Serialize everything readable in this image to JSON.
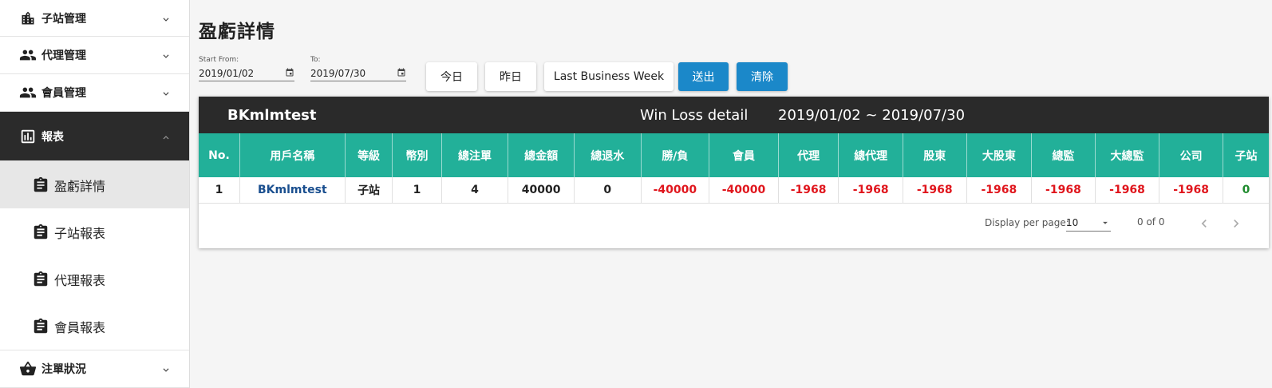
{
  "sidebar": {
    "items": [
      {
        "label": "子站管理",
        "icon": "building-icon"
      },
      {
        "label": "代理管理",
        "icon": "people-icon"
      },
      {
        "label": "會員管理",
        "icon": "people-icon"
      },
      {
        "label": "報表",
        "icon": "chart-icon"
      }
    ],
    "sub_items": [
      {
        "label": "盈虧詳情",
        "icon": "clipboard-icon"
      },
      {
        "label": "子站報表",
        "icon": "clipboard-icon"
      },
      {
        "label": "代理報表",
        "icon": "clipboard-icon"
      },
      {
        "label": "會員報表",
        "icon": "clipboard-icon"
      }
    ],
    "last_item": {
      "label": "注單狀況",
      "icon": "basket-icon"
    }
  },
  "page": {
    "title": "盈虧詳情"
  },
  "filters": {
    "start_label": "Start From:",
    "start_value": "2019/01/02",
    "to_label": "To:",
    "to_value": "2019/07/30"
  },
  "buttons": {
    "today": "今日",
    "yesterday": "昨日",
    "last_business_week": "Last Business Week",
    "submit": "送出",
    "clear": "清除"
  },
  "colors": {
    "accent_blue": "#1b88c9",
    "table_header": "#22b099",
    "negative": "#e0161d",
    "positive": "#1f8b2e"
  },
  "report": {
    "user": "BKmlmtest",
    "title": "Win Loss detail",
    "range": "2019/01/02 ~ 2019/07/30",
    "columns": [
      "No.",
      "用戶名稱",
      "等級",
      "幣別",
      "總注單",
      "總金額",
      "總退水",
      "勝/負",
      "會員",
      "代理",
      "總代理",
      "股東",
      "大股東",
      "總監",
      "大總監",
      "公司",
      "子站"
    ],
    "rows": [
      [
        "1",
        "BKmlmtest",
        "子站",
        "1",
        "4",
        "40000",
        "0",
        "-40000",
        "-40000",
        "-1968",
        "-1968",
        "-1968",
        "-1968",
        "-1968",
        "-1968",
        "-1968",
        "0"
      ]
    ]
  },
  "pager": {
    "label": "Display per page:",
    "per_page": "10",
    "count": "0 of 0"
  }
}
